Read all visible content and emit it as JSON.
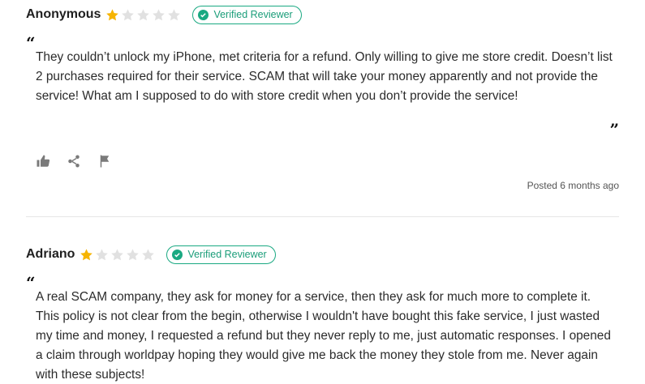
{
  "reviews": [
    {
      "author": "Anonymous",
      "rating": 1,
      "max_rating": 5,
      "badge": "Verified Reviewer",
      "text": "They couldn’t unlock my iPhone, met criteria for a refund. Only willing to give me store credit. Doesn’t list 2 purchases required for their service.  SCAM that will take your money apparently and not provide the service!  What am I supposed to do with store credit when you don’t provide the service!",
      "posted": "Posted 6 months ago",
      "actions": [
        "thumbs-up-icon",
        "share-icon",
        "flag-icon"
      ]
    },
    {
      "author": "Adriano",
      "rating": 1,
      "max_rating": 5,
      "badge": "Verified Reviewer",
      "text": "A real SCAM company, they ask for money for a service, then they ask for much more to complete it. This policy is not clear from the begin, otherwise I wouldn't have bought this fake service, I just wasted my time and money, I requested a refund but they never reply to me, just automatic responses. I opened a claim through worldpay hoping they would give me back the money they stole from me. Never again with these subjects!"
    }
  ],
  "quotes": {
    "open": "“",
    "close": "”"
  },
  "colors": {
    "star_filled": "#f6b400",
    "star_empty": "#e1e1e1",
    "verified": "#1aa982"
  }
}
